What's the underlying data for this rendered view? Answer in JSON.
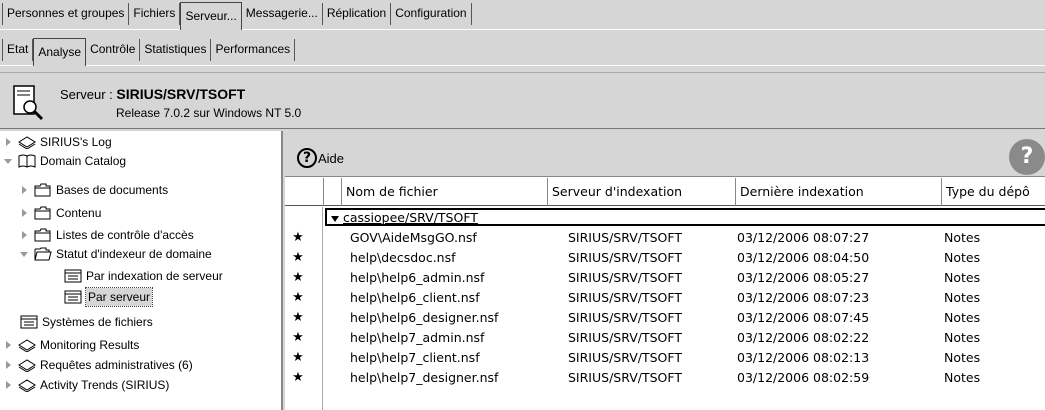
{
  "tabs_primary": [
    "Personnes et groupes",
    "Fichiers",
    "Serveur...",
    "Messagerie...",
    "Réplication",
    "Configuration"
  ],
  "tabs_secondary": [
    "Etat",
    "Analyse",
    "Contrôle",
    "Statistiques",
    "Performances"
  ],
  "active_primary": "Serveur...",
  "active_secondary": "Analyse",
  "header": {
    "prefix": "Serveur : ",
    "server": "SIRIUS/SRV/TSOFT",
    "release": "Release 7.0.2 sur Windows NT 5.0"
  },
  "tree": [
    {
      "label": "SIRIUS's Log",
      "level": 0,
      "twisty": "closed",
      "icon": "database-icon"
    },
    {
      "label": "Domain Catalog",
      "level": 0,
      "twisty": "open",
      "icon": "book-icon"
    },
    {
      "label": "Bases de documents",
      "level": 1,
      "twisty": "closed",
      "icon": "folder-icon"
    },
    {
      "label": "Contenu",
      "level": 1,
      "twisty": "closed",
      "icon": "folder-icon"
    },
    {
      "label": "Listes de contrôle d'accès",
      "level": 1,
      "twisty": "closed",
      "icon": "folder-icon"
    },
    {
      "label": "Statut d'indexeur de domaine",
      "level": 1,
      "twisty": "open",
      "icon": "folder-open-icon"
    },
    {
      "label": "Par indexation de serveur",
      "level": 2,
      "twisty": "none",
      "icon": "view-icon"
    },
    {
      "label": "Par serveur",
      "level": 2,
      "twisty": "none",
      "icon": "view-icon",
      "selected": true
    },
    {
      "label": "Systèmes de fichiers",
      "level": 1,
      "twisty": "none",
      "icon": "view-icon"
    },
    {
      "label": "Monitoring Results",
      "level": 0,
      "twisty": "closed",
      "icon": "database-icon"
    },
    {
      "label": "Requêtes administratives (6)",
      "level": 0,
      "twisty": "closed",
      "icon": "database-icon"
    },
    {
      "label": "Activity Trends (SIRIUS)",
      "level": 0,
      "twisty": "closed",
      "icon": "database-icon"
    }
  ],
  "actionbar": {
    "help_label": "Aide",
    "help_glyph": "?",
    "arrow_glyph": "?"
  },
  "columns": [
    "Nom de fichier",
    "Serveur d'indexation",
    "Dernière indexation",
    "Type du dépô"
  ],
  "category": "cassiopee/SRV/TSOFT",
  "star_glyph": "★",
  "rows": [
    [
      "GOV\\AideMsgGO.nsf",
      "SIRIUS/SRV/TSOFT",
      "03/12/2006 08:07:27",
      "Notes"
    ],
    [
      "help\\decsdoc.nsf",
      "SIRIUS/SRV/TSOFT",
      "03/12/2006 08:04:50",
      "Notes"
    ],
    [
      "help\\help6_admin.nsf",
      "SIRIUS/SRV/TSOFT",
      "03/12/2006 08:05:27",
      "Notes"
    ],
    [
      "help\\help6_client.nsf",
      "SIRIUS/SRV/TSOFT",
      "03/12/2006 08:07:23",
      "Notes"
    ],
    [
      "help\\help6_designer.nsf",
      "SIRIUS/SRV/TSOFT",
      "03/12/2006 08:07:45",
      "Notes"
    ],
    [
      "help\\help7_admin.nsf",
      "SIRIUS/SRV/TSOFT",
      "03/12/2006 08:02:22",
      "Notes"
    ],
    [
      "help\\help7_client.nsf",
      "SIRIUS/SRV/TSOFT",
      "03/12/2006 08:02:13",
      "Notes"
    ],
    [
      "help\\help7_designer.nsf",
      "SIRIUS/SRV/TSOFT",
      "03/12/2006 08:02:59",
      "Notes"
    ]
  ]
}
